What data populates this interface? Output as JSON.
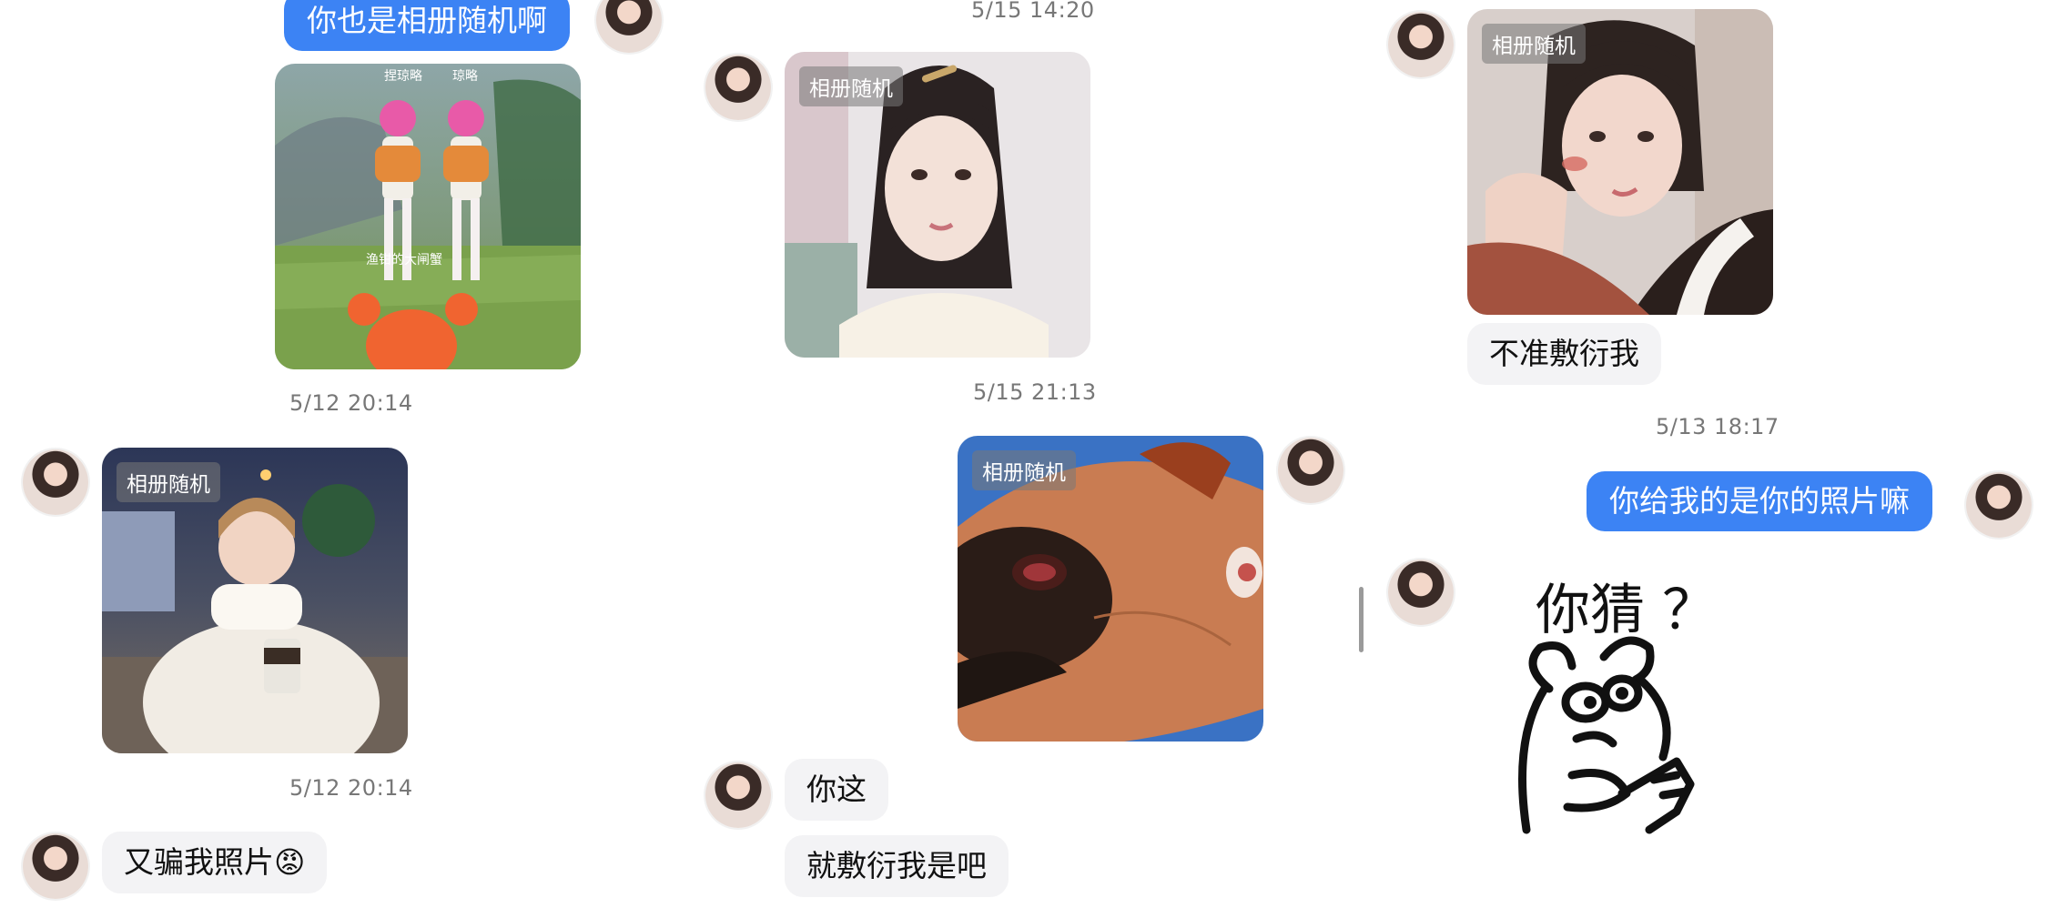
{
  "col1": {
    "msg_top": "你也是相册随机啊",
    "time_1": "5/12 20:14",
    "album_tag": "相册随机",
    "time_2": "5/12 20:14",
    "msg_bottom": "又骗我照片",
    "msg_bottom_emoji": "😡"
  },
  "col2": {
    "time_top": "5/15 14:20",
    "album_tag_1": "相册随机",
    "time_mid": "5/15 21:13",
    "album_tag_2": "相册随机",
    "msg_1": "你这",
    "msg_2": "就敷衍我是吧"
  },
  "col3": {
    "album_tag": "相册随机",
    "msg_1": "不准敷衍我",
    "time": "5/13 18:17",
    "msg_out": "你给我的是你的照片嘛",
    "sticker_text": "你猜 ？"
  },
  "colors": {
    "outgoing_bubble": "#3c83f4",
    "incoming_bubble": "#f3f3f5",
    "timestamp": "#777777"
  },
  "icons": [
    "avatar",
    "angry-face-emoji",
    "bear-sticker"
  ]
}
